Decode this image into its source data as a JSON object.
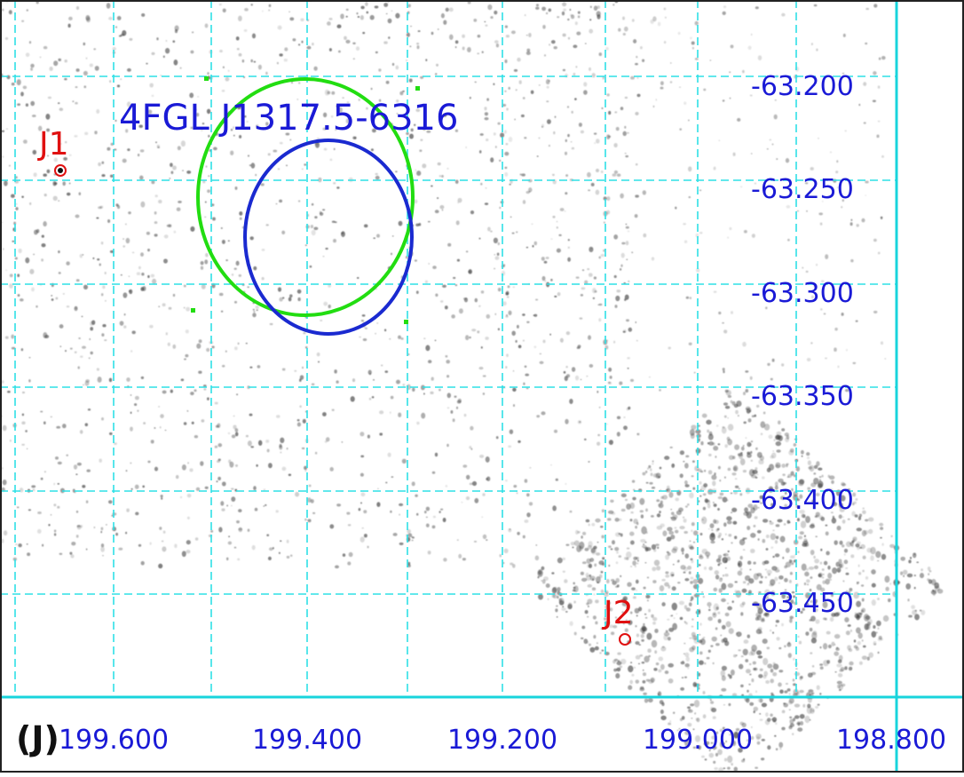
{
  "panel_label": "(J)",
  "source_label": "4FGL J1317.5-6316",
  "markers": [
    {
      "label": "J1"
    },
    {
      "label": "J2"
    }
  ],
  "ra_ticks": [
    "199.600",
    "199.400",
    "199.200",
    "199.000",
    "198.800"
  ],
  "dec_ticks": [
    "-63.200",
    "-63.250",
    "-63.300",
    "-63.350",
    "-63.400",
    "-63.450"
  ],
  "colors": {
    "grid": "#2fe0e6",
    "axis": "#18d4dc",
    "label_blue": "#1a1ad6",
    "marker_red": "#e01010",
    "green_ellipse": "#22dd11",
    "blue_ellipse": "#1a2ad0",
    "border": "#222222"
  }
}
